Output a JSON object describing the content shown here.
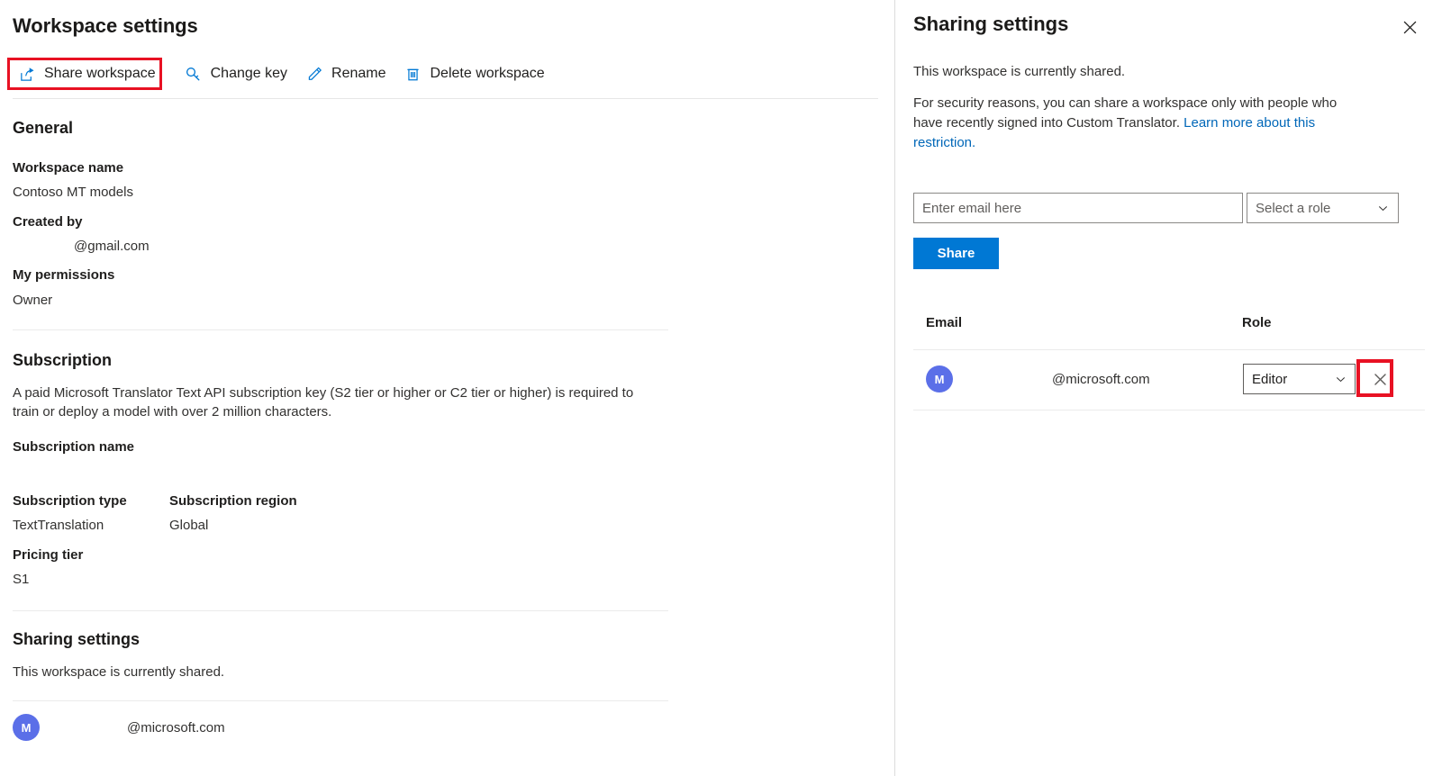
{
  "left": {
    "page_title": "Workspace settings",
    "toolbar": [
      {
        "label": "Share workspace",
        "icon": "share-icon",
        "highlighted": true
      },
      {
        "label": "Change key",
        "icon": "key-icon",
        "highlighted": false
      },
      {
        "label": "Rename",
        "icon": "pencil-icon",
        "highlighted": false
      },
      {
        "label": "Delete workspace",
        "icon": "trash-icon",
        "highlighted": false
      }
    ],
    "general": {
      "heading": "General",
      "workspace_name_label": "Workspace name",
      "workspace_name_value": "Contoso MT models",
      "created_by_label": "Created by",
      "created_by_value": "@gmail.com",
      "permissions_label": "My permissions",
      "permissions_value": "Owner"
    },
    "subscription": {
      "heading": "Subscription",
      "description": "A paid Microsoft Translator Text API subscription key (S2 tier or higher or C2 tier or higher) is required to train or deploy a model with over 2 million characters.",
      "name_label": "Subscription name",
      "name_value": "",
      "type_label": "Subscription type",
      "type_value": "TextTranslation",
      "region_label": "Subscription region",
      "region_value": "Global",
      "pricing_label": "Pricing tier",
      "pricing_value": "S1"
    },
    "sharing": {
      "heading": "Sharing settings",
      "status": "This workspace is currently shared.",
      "member": {
        "avatar_initial": "M",
        "email": "@microsoft.com"
      }
    }
  },
  "right": {
    "title": "Sharing settings",
    "close_label": "✕",
    "status": "This workspace is currently shared.",
    "note_text": "For security reasons, you can share a workspace only with people who have recently signed into Custom Translator. ",
    "note_link": "Learn more about this restriction.",
    "email_placeholder": "Enter email here",
    "email_value": "",
    "role_placeholder": "Select a role",
    "share_button": "Share",
    "table": {
      "headers": {
        "email": "Email",
        "role": "Role"
      },
      "rows": [
        {
          "avatar_initial": "M",
          "email": "@microsoft.com",
          "role": "Editor",
          "remove_label": "✕",
          "remove_highlighted": true
        }
      ]
    }
  },
  "colors": {
    "accent": "#0078d4",
    "link": "#0067b8",
    "highlight": "#e81123",
    "avatar": "#5b6fe8",
    "text": "#201f1e",
    "divider": "#ebebeb"
  }
}
